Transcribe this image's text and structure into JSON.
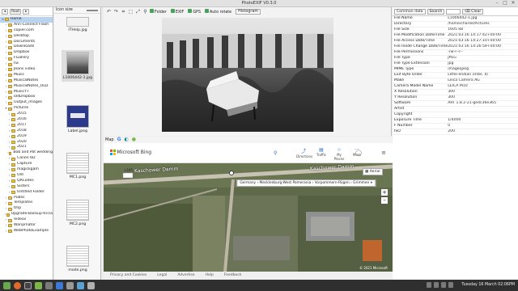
{
  "window": {
    "title": "PhotoEXIF V0.3.0"
  },
  "tree": {
    "root_btn": "Root",
    "items": [
      {
        "label": "Home",
        "depth": 0,
        "arrow": "▾",
        "selected": true
      },
      {
        "label": "Ann-Connect Flash",
        "depth": 1,
        "arrow": "›"
      },
      {
        "label": "copier.com",
        "depth": 1,
        "arrow": "›"
      },
      {
        "label": "Desktop",
        "depth": 1,
        "arrow": "›"
      },
      {
        "label": "Documents",
        "depth": 1,
        "arrow": "›"
      },
      {
        "label": "Downloads",
        "depth": 1,
        "arrow": "›"
      },
      {
        "label": "Dropbox",
        "depth": 1,
        "arrow": "›"
      },
      {
        "label": "FGallery",
        "depth": 1,
        "arrow": "›"
      },
      {
        "label": "ha",
        "depth": 1,
        "arrow": "›"
      },
      {
        "label": "Jeans video",
        "depth": 1,
        "arrow": "›"
      },
      {
        "label": "Music",
        "depth": 1,
        "arrow": "›"
      },
      {
        "label": "MusicalNotes",
        "depth": 1,
        "arrow": "›"
      },
      {
        "label": "MusicalNotes_OLD",
        "depth": 1,
        "arrow": "›"
      },
      {
        "label": "MusicYT",
        "depth": 1,
        "arrow": "›"
      },
      {
        "label": "oldDropbox",
        "depth": 1,
        "arrow": "›"
      },
      {
        "label": "Output_images",
        "depth": 1,
        "arrow": "›"
      },
      {
        "label": "Pictures",
        "depth": 1,
        "arrow": "▾"
      },
      {
        "label": "2015",
        "depth": 2,
        "arrow": "›"
      },
      {
        "label": "2016",
        "depth": 2,
        "arrow": "›"
      },
      {
        "label": "2017",
        "depth": 2,
        "arrow": "›"
      },
      {
        "label": "2018",
        "depth": 2,
        "arrow": "›"
      },
      {
        "label": "2019",
        "depth": 2,
        "arrow": "›"
      },
      {
        "label": "2020",
        "depth": 2,
        "arrow": "›"
      },
      {
        "label": "2021",
        "depth": 2,
        "arrow": "›"
      },
      {
        "label": "Bob and Pat wedding",
        "depth": 2,
        "arrow": "›"
      },
      {
        "label": "Canon 6D",
        "depth": 2,
        "arrow": "›"
      },
      {
        "label": "Capture",
        "depth": 2,
        "arrow": "›"
      },
      {
        "label": "magickgam",
        "depth": 2,
        "arrow": "›"
      },
      {
        "label": "Old",
        "depth": 2,
        "arrow": "›"
      },
      {
        "label": "QRCodes",
        "depth": 2,
        "arrow": "›"
      },
      {
        "label": "Sisters",
        "depth": 2,
        "arrow": "›"
      },
      {
        "label": "Untitled Folder",
        "depth": 2,
        "arrow": "›"
      },
      {
        "label": "Public",
        "depth": 1,
        "arrow": "›"
      },
      {
        "label": "Templates",
        "depth": 1,
        "arrow": "›"
      },
      {
        "label": "tmp",
        "depth": 1,
        "arrow": "›"
      },
      {
        "label": "Upgrade-Backup-tricia",
        "depth": 1,
        "arrow": "›"
      },
      {
        "label": "Videos",
        "depth": 1,
        "arrow": "›"
      },
      {
        "label": "Waripmator",
        "depth": 1,
        "arrow": "›"
      },
      {
        "label": "WebPhotoExample",
        "depth": 1,
        "arrow": "›"
      }
    ]
  },
  "thumbs": {
    "header": "Icon size",
    "items": [
      {
        "caption": "ITHelp.jpg"
      },
      {
        "caption": "L1006442-1.jpg",
        "badge": "1280 4032"
      },
      {
        "caption": "Label.jpeg",
        "badge": "7 sat 32 Fv"
      },
      {
        "caption": "MC1.png",
        "badge": "820 7"
      },
      {
        "caption": "MC2.png"
      },
      {
        "caption": "mode.png"
      }
    ]
  },
  "toolbar": {
    "folder": "Folder",
    "exif": "EXIF",
    "gps": "GPS",
    "autorotate": "Auto rotate",
    "histogram": "Histogram"
  },
  "exif_panel": {
    "tab_common": "Common data",
    "tab_search": "Search",
    "clear": "Clear",
    "rows": [
      [
        "File Name",
        "L1006442-1.jpg"
      ],
      [
        "Directory",
        "/home/charlie/Pictures"
      ],
      [
        "File Size",
        "1605 kB"
      ],
      [
        "File Modification Date/Time",
        "2021:03:16 14:17:42+00:00"
      ],
      [
        "File Access Date/Time",
        "2021:03:16 14:27:10+00:00"
      ],
      [
        "File Inode Change Date/Time",
        "2021:03:16 14:26:59+00:00"
      ],
      [
        "File Permissions",
        "-rw-r--r--"
      ],
      [
        "File Type",
        "JPEG"
      ],
      [
        "File Type Extension",
        "jpg"
      ],
      [
        "MIME Type",
        "image/jpeg"
      ],
      [
        "Exif Byte Order",
        "Little-endian (Intel, II)"
      ],
      [
        "Make",
        "Leica Camera AG"
      ],
      [
        "Camera Model Name",
        "LEICA M10"
      ],
      [
        "X Resolution",
        "300"
      ],
      [
        "Y Resolution",
        "300"
      ],
      [
        "Software",
        "ART 1.8.2-21-ge4c36e365"
      ],
      [
        "Artist",
        ""
      ],
      [
        "Copyright",
        ""
      ],
      [
        "Exposure Time",
        "1/4000"
      ],
      [
        "F Number",
        "0"
      ],
      [
        "ISO",
        "200"
      ]
    ]
  },
  "map": {
    "label": "Map",
    "bing": "Microsoft Bing",
    "nav": [
      "Directions",
      "Traffic",
      "My Places",
      "More"
    ],
    "road1": "Kaschower Damm",
    "road2": "Kaschower Damm",
    "route": "L165",
    "aerial": "Aerial",
    "breadcrumb": "Germany › Mecklenburg-West Pomerania › Vorpommern-Rügen › Grimmen",
    "copyright": "© 2021 Microsoft",
    "footer": [
      "Privacy and Cookies",
      "Legal",
      "Advertise",
      "Help",
      "Feedback"
    ]
  },
  "taskbar": {
    "clock": "Tuesday 16 March 02:06PM"
  },
  "colors": {
    "selection": "#b9d4f0",
    "folder": "#e8c35a",
    "accent": "#2266cc"
  }
}
